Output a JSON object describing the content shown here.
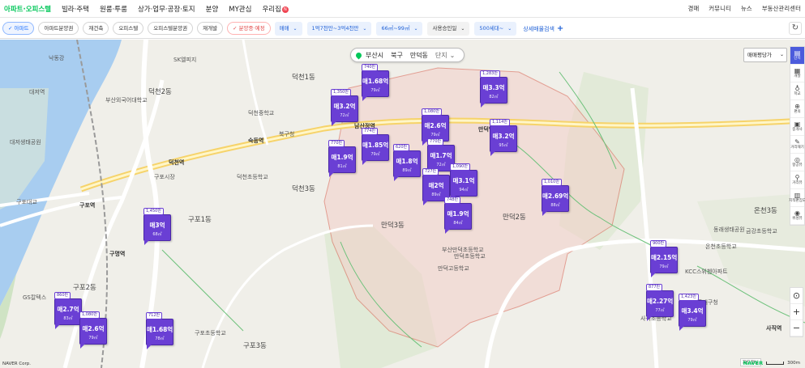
{
  "nav": {
    "items": [
      "아파트·오피스텔",
      "빌라·주택",
      "원룸·투룸",
      "상가·업무·공장·토지",
      "분양",
      "MY관심",
      "우리집"
    ],
    "badge": "N",
    "right": [
      "경매",
      "커뮤니티",
      "뉴스",
      "부동산관리센터"
    ]
  },
  "filters": {
    "chips": [
      "아파트",
      "아파트분양권",
      "재건축",
      "오피스텔",
      "오피스텔분양권",
      "재개발",
      "분양중·예정"
    ],
    "selects": [
      "매매",
      "1억7천만~3억4천만",
      "66㎡~99㎡",
      "사용승인일",
      "500세대~"
    ],
    "detail": "상세매물검색",
    "detail_plus": "+",
    "refresh": "↻"
  },
  "breadcrumb": {
    "city": "부산시",
    "district": "북구",
    "dong": "만덕동",
    "complex": "단지",
    "chev": "⌄"
  },
  "sort_select": {
    "label": "매매평당가",
    "chev": "⌄"
  },
  "toolbar": [
    {
      "icon": "▤",
      "label": "단지"
    },
    {
      "icon": "▦",
      "label": "개발"
    },
    {
      "icon": "♁",
      "label": "학교"
    },
    {
      "icon": "⊕",
      "label": "편의"
    },
    {
      "icon": "▣",
      "label": "중개사"
    },
    {
      "icon": "✎",
      "label": "거리재기"
    },
    {
      "icon": "◎",
      "label": "항공뷰"
    },
    {
      "icon": "⚲",
      "label": "거리뷰"
    },
    {
      "icon": "▥",
      "label": "지적편집도"
    },
    {
      "icon": "◉",
      "label": "위성뷰"
    }
  ],
  "zoom": {
    "locate": "⊙",
    "in": "+",
    "out": "−"
  },
  "markers": [
    {
      "count": "740만",
      "price": "매1.68억",
      "area": "79㎡"
    },
    {
      "count": "1,350만",
      "price": "매3.2억",
      "area": "72㎡"
    },
    {
      "count": "1,283만",
      "price": "매3.3억",
      "area": "82㎡"
    },
    {
      "count": "1,080만",
      "price": "매2.6억",
      "area": "79㎡"
    },
    {
      "count": "1,114만",
      "price": "매3.2억",
      "area": "95㎡"
    },
    {
      "count": "774만",
      "price": "매1.85억",
      "area": "79㎡"
    },
    {
      "count": "770만",
      "price": "매1.9억",
      "area": "81㎡"
    },
    {
      "count": "620만",
      "price": "매1.8억",
      "area": "89㎡"
    },
    {
      "count": "770만",
      "price": "매1.7억",
      "area": "72㎡"
    },
    {
      "count": "727만",
      "price": "매2억",
      "area": "89㎡"
    },
    {
      "count": "1,090만",
      "price": "매3.1억",
      "area": "94㎡"
    },
    {
      "count": "748만",
      "price": "매1.9억",
      "area": "84㎡"
    },
    {
      "count": "1,010만",
      "price": "매2.69억",
      "area": "88㎡"
    },
    {
      "count": "1,450만",
      "price": "매3억",
      "area": "68㎡"
    },
    {
      "count": "900만",
      "price": "매2.15억",
      "area": "79㎡"
    },
    {
      "count": "877만",
      "price": "매2.27억",
      "area": "77㎡"
    },
    {
      "count": "1,423만",
      "price": "매3.4억",
      "area": "79㎡"
    },
    {
      "count": "860만",
      "price": "매2.7억",
      "area": "83㎡"
    },
    {
      "count": "1,080만",
      "price": "매2.6억",
      "area": "79㎡"
    },
    {
      "count": "712만",
      "price": "매1.68억",
      "area": "78㎡"
    }
  ],
  "labels": {
    "big": [
      "덕천1동",
      "덕천3동",
      "구포1동",
      "구포2동",
      "만덕3동",
      "만덕2동",
      "온천3동",
      "구포3동",
      "덕천2동"
    ],
    "station": [
      "남산정역",
      "숙등역",
      "덕천역",
      "구포역",
      "구명역",
      "사직역",
      "만덕역"
    ],
    "small": [
      "대저생태공원",
      "대저역",
      "SK엘피지",
      "부산외국어대학교",
      "덕천초등학교",
      "덕천중학교",
      "북구청",
      "덕천초등학교",
      "만덕고등학교",
      "부산만덕초등학교",
      "온천초등학교",
      "금강초등학교",
      "구포초등학교",
      "사직초등학교",
      "KCC스위첸아파트",
      "동래생태공원",
      "구포대교",
      "낙동강",
      "GS칼텍스",
      "동래구청",
      "만덕초등학교",
      "구포시장"
    ]
  },
  "footer": {
    "copyright": "NAVER Corp.",
    "guide": "지도정보",
    "logo": "NAVER",
    "scale": "300m"
  }
}
